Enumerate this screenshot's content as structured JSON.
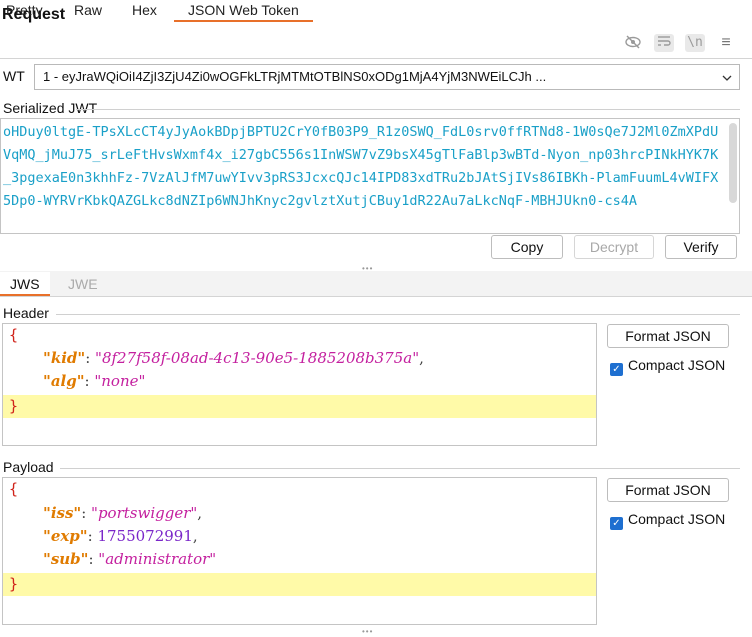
{
  "panel": {
    "title": "Request"
  },
  "tabs": [
    {
      "label": "Pretty"
    },
    {
      "label": "Raw"
    },
    {
      "label": "Hex"
    },
    {
      "label": "JSON Web Token"
    }
  ],
  "toolbar_icons": [
    "eye-off-icon",
    "wrap-lines-icon",
    "newline-icon",
    "menu-icon"
  ],
  "toolbar": {
    "newline_glyph": "\\n",
    "menu_glyph": "≡"
  },
  "wt": {
    "label": "WT",
    "selected": "1 - eyJraWQiOiI4ZjI3ZjU4Zi0wOGFkLTRjMTMtOTBlNS0xODg1MjA4YjM3NWEiLCJh ..."
  },
  "serialized": {
    "label": "Serialized JWT",
    "text": "oHDuy0ltgE-TPsXLcCT4yJyAokBDpjBPTU2CrY0fB03P9_R1z0SWQ_FdL0srv0ffRTNd8-1W0sQe7J2Ml0ZmXPdUVqMQ_jMuJ75_srLeFtHvsWxmf4x_i27gbC556s1InWSW7vZ9bsX45gTlFaBlp3wBTd-Nyon_np03hrcPINkHYK7K_3pgexaE0n3khhFz-7VzAlJfM7uwYIvv3pRS3JcxcQJc14IPD83xdTRu2bJAtSjIVs86IBKh-PlamFuumL4vWIFX5Dp0-WYRVrKbkQAZGLkc8dNZIp6WNJhKnyc2gvlztXutjCBuy1dR22Au7aLkcNqF-MBHJUkn0-cs4A",
    "buttons": {
      "copy": "Copy",
      "decrypt": "Decrypt",
      "verify": "Verify"
    }
  },
  "subtabs": {
    "jws": "JWS",
    "jwe": "JWE"
  },
  "header": {
    "label": "Header",
    "open": "{",
    "close": "}",
    "fields": [
      {
        "key": "\"kid\"",
        "value": "\"8f27f58f-08ad-4c13-90e5-1885208b375a\"",
        "comma": ","
      },
      {
        "key": "\"alg\"",
        "value": "\"none\"",
        "comma": ""
      }
    ],
    "format_button": "Format JSON",
    "compact_label": "Compact JSON",
    "compact_checked": true
  },
  "payload": {
    "label": "Payload",
    "open": "{",
    "close": "}",
    "fields": [
      {
        "key": "\"iss\"",
        "value": "\"portswigger\"",
        "comma": ","
      },
      {
        "key": "\"exp\"",
        "value": "1755072991",
        "comma": ","
      },
      {
        "key": "\"sub\"",
        "value": "\"administrator\"",
        "comma": ""
      }
    ],
    "format_button": "Format JSON",
    "compact_label": "Compact JSON",
    "compact_checked": true
  },
  "colors": {
    "accent": "#e8702a",
    "jwt_text": "#1aa0c8",
    "json_key": "#e07b00",
    "json_string": "#c4209f",
    "json_number": "#7a26c9",
    "brace": "#d0231a",
    "highlight": "#fffaa8",
    "checkbox": "#1e6fd0"
  }
}
